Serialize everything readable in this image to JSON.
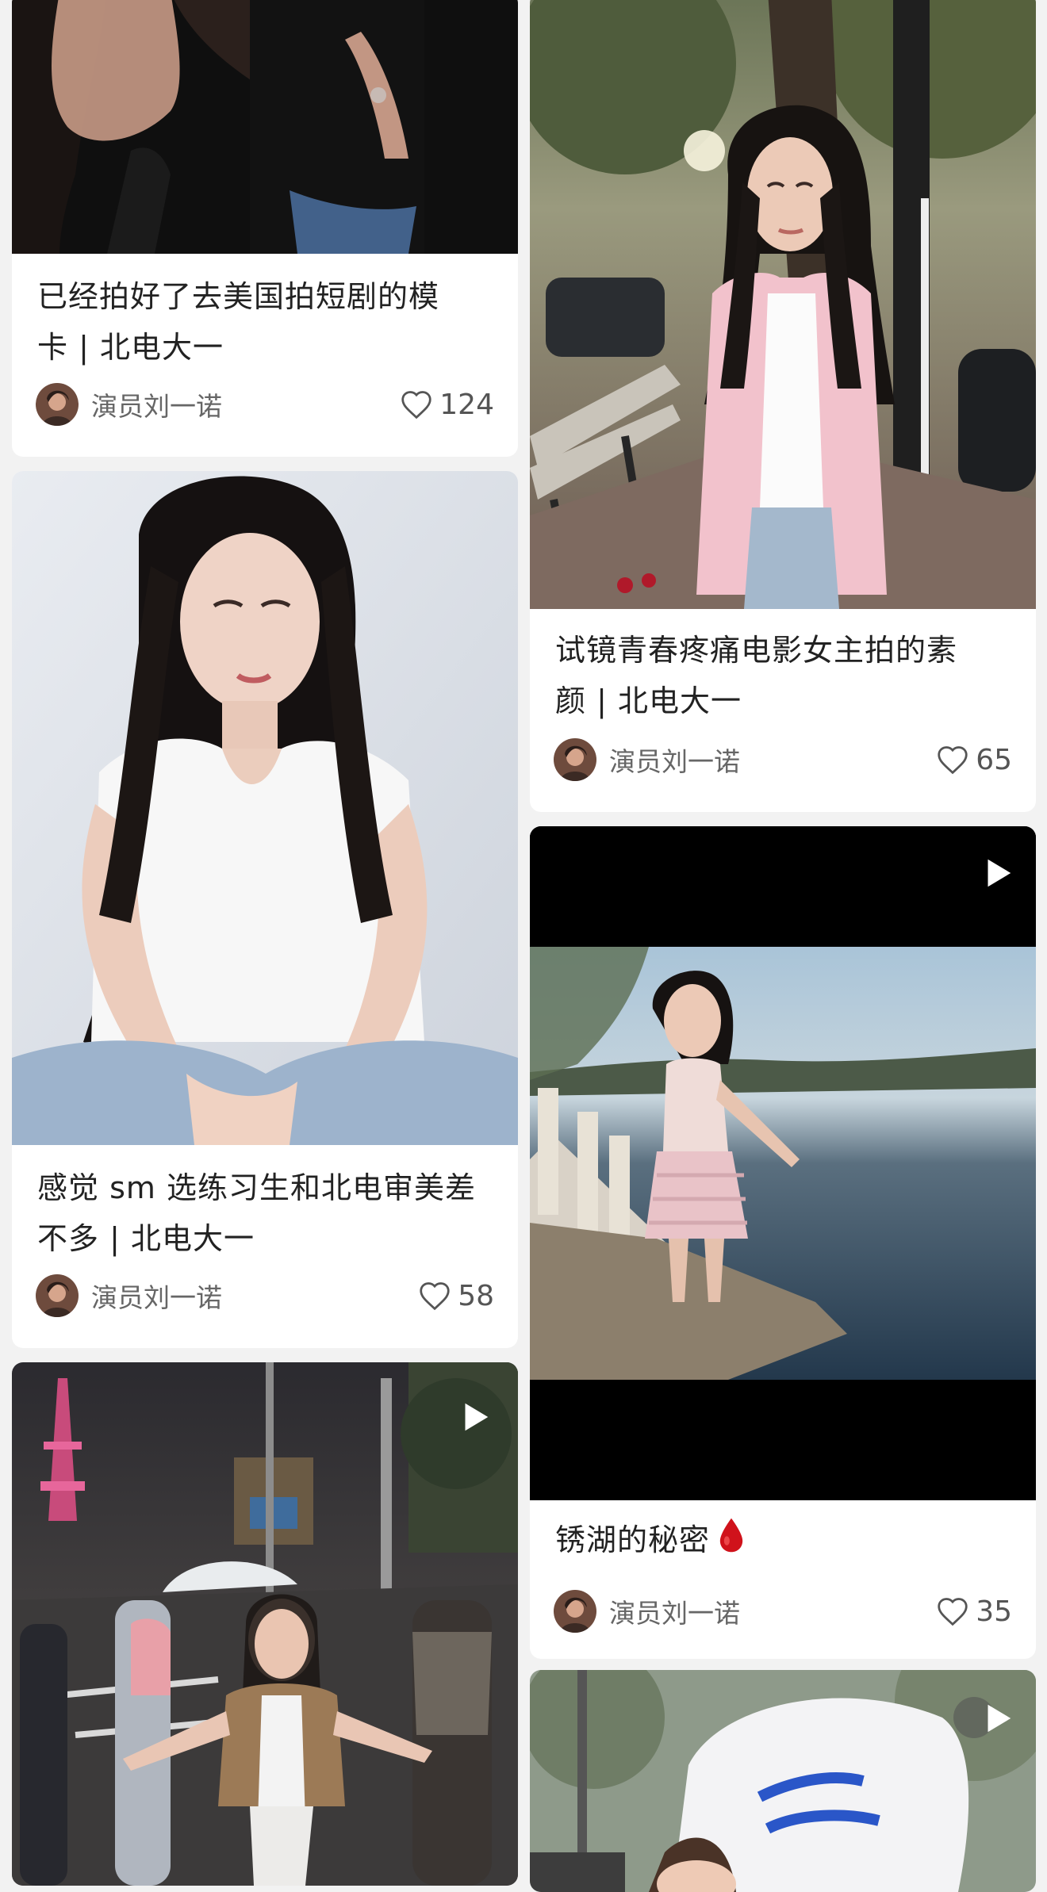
{
  "feed": {
    "left_column": [
      {
        "title_line1": "已经拍好了去美国拍短剧的模",
        "title_line2": "卡 | 北电大一",
        "author": "演员刘一诺",
        "likes": "124",
        "media_type": "image"
      },
      {
        "title_line1": "感觉 sm 选练习生和北电审美差",
        "title_line2": "不多 | 北电大一",
        "author": "演员刘一诺",
        "likes": "58",
        "media_type": "image"
      },
      {
        "title_line1": "",
        "title_line2": "",
        "author": "",
        "likes": "",
        "media_type": "video"
      }
    ],
    "right_column": [
      {
        "title_line1": "试镜青春疼痛电影女主拍的素",
        "title_line2": "颜 | 北电大一",
        "author": "演员刘一诺",
        "likes": "65",
        "media_type": "image"
      },
      {
        "title_line1": "锈湖的秘密",
        "title_emoji": "drop-of-blood",
        "author": "演员刘一诺",
        "likes": "35",
        "media_type": "video"
      },
      {
        "title_line1": "",
        "author": "",
        "likes": "",
        "media_type": "video"
      }
    ]
  },
  "icons": {
    "like": "heart-outline-icon",
    "play": "play-icon"
  },
  "colors": {
    "background": "#f2f2f2",
    "card": "#ffffff",
    "title_text": "#222222",
    "meta_text": "#666666",
    "drop": "#d0121b"
  }
}
